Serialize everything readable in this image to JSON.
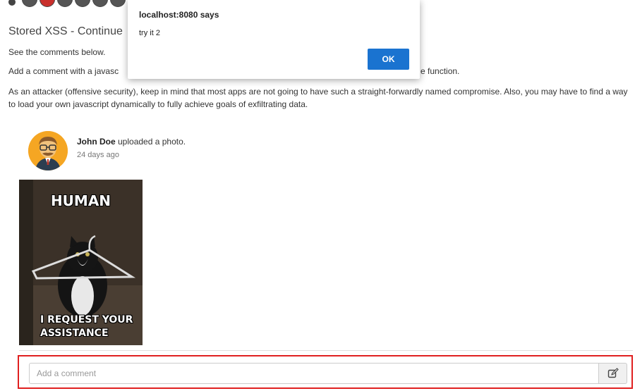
{
  "lesson": {
    "progress": {
      "steps": [
        "dark",
        "red",
        "dark",
        "dark",
        "dark",
        "dark",
        "green"
      ]
    },
    "title": "Stored XSS - Continue",
    "line1": "See the comments below.",
    "line2_start": "Add a comment with a javasc",
    "line2_end": "e function.",
    "paragraph": "As an attacker (offensive security), keep in mind that most apps are not going to have such a straight-forwardly named compromise. Also, you may have to find a way to load your own javascript dynamically to fully achieve goals of exfiltrating data."
  },
  "post": {
    "author": "John Doe",
    "action": " uploaded a photo.",
    "time": "24 days ago",
    "avatar_icon": "avatar-man-glasses",
    "photo": {
      "top_caption": "HUMAN",
      "bottom_caption_1": "I REQUEST YOUR",
      "bottom_caption_2": "ASSISTANCE"
    }
  },
  "comment": {
    "placeholder": "Add a comment",
    "submit_icon": "edit-icon",
    "highlight_color": "#e02020"
  },
  "dialog": {
    "title": "localhost:8080 says",
    "message": "try it 2",
    "ok_label": "OK",
    "ok_color": "#1a73d0"
  }
}
